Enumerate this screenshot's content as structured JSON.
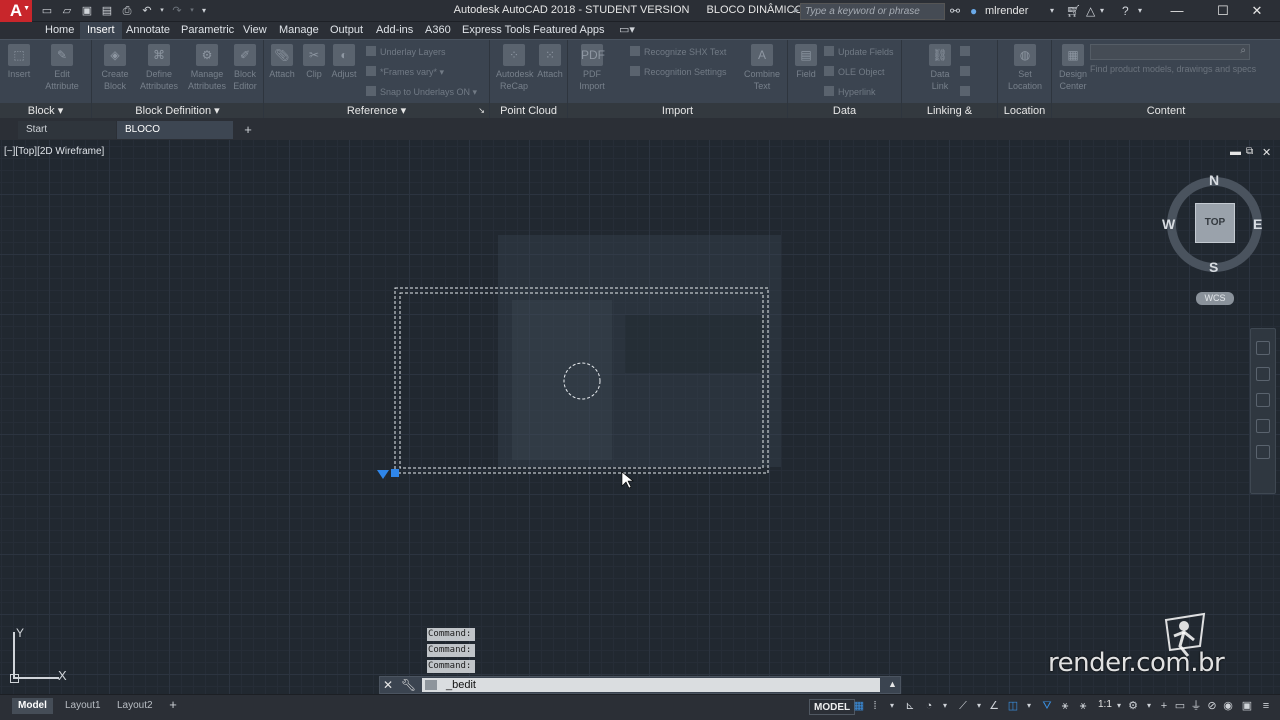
{
  "titlebar": {
    "app_name": "Autodesk AutoCAD 2018 - STUDENT VERSION",
    "file_name": "BLOCO DINÂMICO.dwg",
    "search_placeholder": "Type a keyword or phrase",
    "user": "mlrender"
  },
  "ribbon_tabs": [
    "Home",
    "Insert",
    "Annotate",
    "Parametric",
    "View",
    "Manage",
    "Output",
    "Add-ins",
    "A360",
    "Express Tools",
    "Featured Apps"
  ],
  "active_ribbon_tab": "Insert",
  "panels": {
    "block": {
      "title": "Block",
      "buttons": [
        "Insert",
        "Edit Attribute"
      ]
    },
    "block_definition": {
      "title": "Block Definition",
      "buttons": [
        "Create Block",
        "Define Attributes",
        "Manage Attributes",
        "Block Editor"
      ]
    },
    "reference": {
      "title": "Reference",
      "buttons": [
        "Attach",
        "Clip",
        "Adjust"
      ],
      "small": [
        "Underlay Layers",
        "*Frames vary*",
        "Snap to Underlays ON"
      ]
    },
    "point_cloud": {
      "title": "Point Cloud",
      "buttons": [
        "Autodesk ReCap",
        "Attach"
      ]
    },
    "import": {
      "title": "Import",
      "buttons": [
        "PDF Import",
        "Combine Text"
      ],
      "small": [
        "Recognize SHX Text",
        "Recognition Settings"
      ]
    },
    "data": {
      "title": "Data",
      "buttons": [
        "Field"
      ],
      "small": [
        "Update Fields",
        "OLE Object",
        "Hyperlink"
      ]
    },
    "linking": {
      "title": "Linking & Extraction",
      "buttons": [
        "Data Link"
      ]
    },
    "location": {
      "title": "Location",
      "buttons": [
        "Set Location"
      ]
    },
    "content": {
      "title": "Content",
      "buttons": [
        "Design Center"
      ],
      "description": "Find product models, drawings and specs"
    }
  },
  "file_tabs": [
    {
      "label": "Start",
      "active": false
    },
    {
      "label": "BLOCO DINÂMICO*",
      "active": true
    }
  ],
  "viewport": {
    "label": "[−][Top][2D Wireframe]",
    "viewcube": {
      "top_face": "TOP",
      "north": "N",
      "south": "S",
      "east": "E",
      "west": "W",
      "ucs": "WCS"
    }
  },
  "ucs": {
    "x": "X",
    "y": "Y"
  },
  "command_history": [
    "Command:",
    "Command:",
    "Command:"
  ],
  "command_line": {
    "value": "_bedit"
  },
  "status": {
    "layout_tabs": [
      "Model",
      "Layout1",
      "Layout2"
    ],
    "active_layout": "Model",
    "space": "MODEL",
    "annotation_scale": "1:1"
  },
  "watermark": "render.com.br",
  "colors": {
    "accent": "#3a8fe0",
    "app_logo": "#c8262b",
    "grid_major": "#2c3440"
  }
}
